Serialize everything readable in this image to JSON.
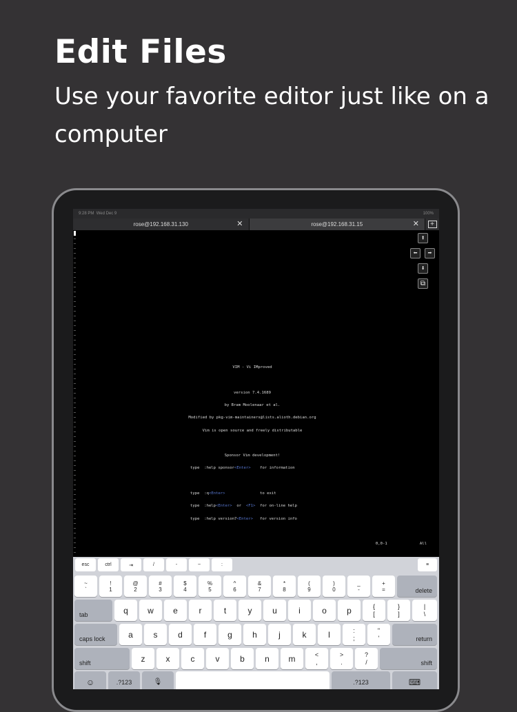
{
  "promo": {
    "headline": "Edit Files",
    "subline": "Use your favorite editor just like on a computer"
  },
  "status": {
    "time": "9:28 PM",
    "date": "Wed Dec 9",
    "battery": "100%"
  },
  "tabs": [
    {
      "label": "rose@192.168.31.130",
      "close": "✕"
    },
    {
      "label": "rose@192.168.31.15",
      "close": "✕"
    }
  ],
  "tab_add": "+",
  "arrows": {
    "up": "⬆",
    "left": "⬅",
    "right": "➡",
    "down": "⬇",
    "paste": "⧉"
  },
  "vim": {
    "title": "VIM - Vi IMproved",
    "version": "version 7.4.1689",
    "author": "by Bram Moolenaar et al.",
    "modified": "Modified by pkg-vim-maintainers@lists.alioth.debian.org",
    "license": "Vim is open source and freely distributable",
    "sponsor_head": "Sponsor Vim development!",
    "l1a": "type  :help sponsor",
    "l1b": "<Enter>",
    "l1c": "    for information",
    "l2a": "type  :q",
    "l2b": "<Enter>",
    "l2c": "               to exit",
    "l3a": "type  :help",
    "l3b": "<Enter>",
    "l3c": "  or  ",
    "l3d": "<F1>",
    "l3e": "  for on-line help",
    "l4a": "type  :help version7",
    "l4b": "<Enter>",
    "l4c": "   for version info",
    "ruler_pos": "0,0-1",
    "ruler_all": "All"
  },
  "toolbar": [
    "esc",
    "ctrl",
    "⇥",
    "/",
    "-",
    "~",
    ":",
    "≡"
  ],
  "keys": {
    "num": [
      [
        "~",
        "`"
      ],
      [
        "!",
        "1"
      ],
      [
        "@",
        "2"
      ],
      [
        "#",
        "3"
      ],
      [
        "$",
        "4"
      ],
      [
        "%",
        "5"
      ],
      [
        "^",
        "6"
      ],
      [
        "&",
        "7"
      ],
      [
        "*",
        "8"
      ],
      [
        "(",
        "9"
      ],
      [
        ")",
        "0"
      ],
      [
        "_",
        "-"
      ],
      [
        "+",
        "="
      ]
    ],
    "delete": "delete",
    "tab": "tab",
    "row1": [
      "q",
      "w",
      "e",
      "r",
      "t",
      "y",
      "u",
      "i",
      "o",
      "p"
    ],
    "row1_sym": [
      [
        "{",
        "["
      ],
      [
        "}",
        "]"
      ],
      [
        "|",
        "\\"
      ]
    ],
    "caps": "caps lock",
    "row2": [
      "a",
      "s",
      "d",
      "f",
      "g",
      "h",
      "j",
      "k",
      "l"
    ],
    "row2_sym": [
      [
        ":",
        ";"
      ],
      [
        "\"",
        "'"
      ]
    ],
    "return": "return",
    "shift_l": "shift",
    "row3": [
      "z",
      "x",
      "c",
      "v",
      "b",
      "n",
      "m"
    ],
    "row3_sym": [
      [
        "<",
        ","
      ],
      [
        ">",
        "."
      ],
      [
        "?",
        "/"
      ]
    ],
    "shift_r": "shift",
    "emoji": "☺",
    "mode_l": ".?123",
    "mic": "🎙",
    "mode_r": ".?123",
    "hide": "⌨"
  }
}
